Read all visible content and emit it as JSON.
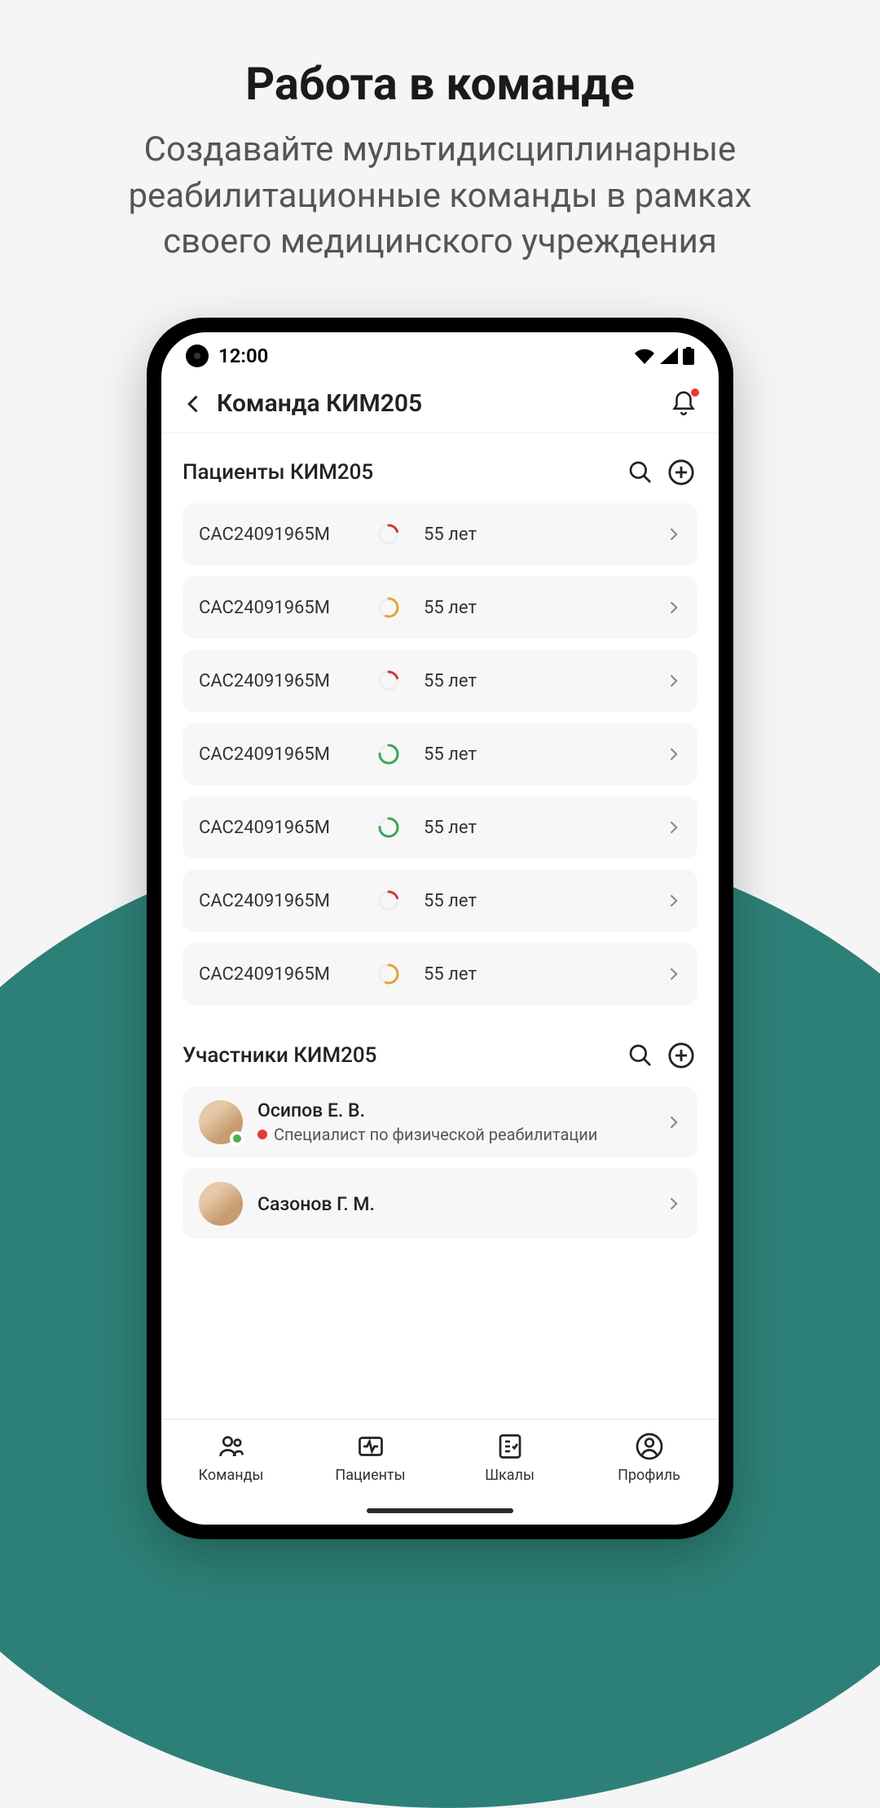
{
  "page": {
    "title": "Работа в команде",
    "subtitle": "Создавайте мультидисциплинарные реабилитационные команды в рамках своего медицинского учреждения"
  },
  "status_bar": {
    "time": "12:00"
  },
  "header": {
    "title": "Команда КИМ205"
  },
  "sections": {
    "patients_title": "Пациенты КИМ205",
    "members_title": "Участники КИМ205"
  },
  "patients": [
    {
      "id": "CAC24091965M",
      "age": "55 лет",
      "ring_color": "#d13a3a",
      "ring_pct": 20
    },
    {
      "id": "CAC24091965M",
      "age": "55 лет",
      "ring_color": "#e6a23c",
      "ring_pct": 55
    },
    {
      "id": "CAC24091965M",
      "age": "55 лет",
      "ring_color": "#d13a3a",
      "ring_pct": 20
    },
    {
      "id": "CAC24091965M",
      "age": "55 лет",
      "ring_color": "#3aa655",
      "ring_pct": 75
    },
    {
      "id": "CAC24091965M",
      "age": "55 лет",
      "ring_color": "#3aa655",
      "ring_pct": 75
    },
    {
      "id": "CAC24091965M",
      "age": "55 лет",
      "ring_color": "#d13a3a",
      "ring_pct": 20
    },
    {
      "id": "CAC24091965M",
      "age": "55 лет",
      "ring_color": "#e6a23c",
      "ring_pct": 55
    }
  ],
  "members": [
    {
      "name": "Осипов Е. В.",
      "role": "Специалист по физической реабилитации",
      "online": true
    },
    {
      "name": "Сазонов Г. М.",
      "role": "",
      "online": false
    }
  ],
  "nav": {
    "teams": "Команды",
    "patients": "Пациенты",
    "scales": "Шкалы",
    "profile": "Профиль"
  }
}
